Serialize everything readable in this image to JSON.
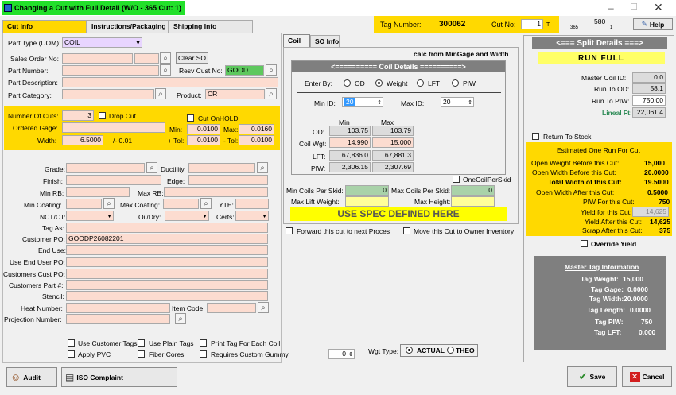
{
  "title": "Changing a Cut with Full Detail  (W/O - 365   Cut: 1)",
  "tag_label": "Tag Number:",
  "tag_number": "300062",
  "cut_no_label": "Cut No:",
  "cut_no": "1",
  "cut_no_suffix": "T",
  "hdr_580": "580",
  "hdr_365": "365",
  "hdr_1": "1",
  "help": "Help",
  "tabs": [
    "Cut Info",
    "Instructions/Packaging",
    "Shipping Info"
  ],
  "left": {
    "part_type_label": "Part Type (UOM):",
    "part_type": "COIL",
    "sales_order_label": "Sales Order No:",
    "clear_so": "Clear SO",
    "part_number_label": "Part Number:",
    "resv_cust_label": "Resv Cust No:",
    "resv_cust": "GOOD",
    "part_desc_label": "Part Description:",
    "part_cat_label": "Part Category:",
    "product_label": "Product:",
    "product": "CR",
    "num_cuts_label": "Number Of Cuts:",
    "num_cuts": "3",
    "drop_cut": "Drop Cut",
    "cut_onhold": "Cut OnHOLD",
    "ordered_gage_label": "Ordered Gage:",
    "min_label": "Min:",
    "min_val": "0.0100",
    "max_label": "Max:",
    "max_val": "0.0160",
    "width_label": "Width:",
    "width": "6.5000",
    "width_tol": "+/- 0.01",
    "ptol_label": "+ Tol:",
    "ptol": "0.0100",
    "mtol_label": "- Tol:",
    "mtol": "0.0100",
    "grade": "Grade:",
    "ductility": "Ductility",
    "finish": "Finish:",
    "edge": "Edge:",
    "min_rb": "Min RB:",
    "max_rb": "Max RB:",
    "min_coating": "Min Coating:",
    "max_coating": "Max Coating:",
    "yte": "YTE:",
    "nct": "NCT/CT:",
    "oildry": "Oil/Dry:",
    "certs": "Certs:",
    "tag_as": "Tag As:",
    "customer_po_label": "Customer PO:",
    "customer_po": "GOODP26082201",
    "end_use": "End Use:",
    "end_user_po": "Use End User PO:",
    "customers_cust_po": "Customers Cust PO:",
    "customers_part": "Customers Part #:",
    "stencil": "Stencil:",
    "heat_number": "Heat Number:",
    "item_code": "Item Code:",
    "projection_number": "Projection Number:",
    "use_customer_tags": "Use Customer Tags",
    "use_plain_tags": "Use Plain Tags",
    "print_tag_each_coil": "Print Tag For Each Coil",
    "apply_pvc": "Apply PVC",
    "fiber_cores": "Fiber Cores",
    "requires_custom_gummy": "Requires Custom Gummy",
    "gummy_val": "0",
    "wgt_type_label": "Wgt Type:",
    "actual": "ACTUAL",
    "theo": "THEO"
  },
  "coil": {
    "tab_coil": "Coil",
    "tab_so": "SO Info",
    "calc_note": "calc from MinGage and Width",
    "details_title": "<========== Coil Details ==========>",
    "enter_by": "Enter By:",
    "od": "OD",
    "weight": "Weight",
    "lft": "LFT",
    "piw": "PIW",
    "min_id_label": "Min ID:",
    "min_id": "20",
    "max_id_label": "Max ID:",
    "max_id": "20",
    "col_min": "Min",
    "col_max": "Max",
    "od_label": "OD:",
    "od_min": "103.75",
    "od_max": "103.79",
    "wgt_label": "Coil Wgt:",
    "wgt_min": "14,990",
    "wgt_max": "15,000",
    "lft_label": "LFT:",
    "lft_min": "67,836.0",
    "lft_max": "67,881.3",
    "piw_label": "PIW:",
    "piw_min": "2,306.15",
    "piw_max": "2,307.69",
    "one_coil": "OneCoilPerSkid",
    "min_coils_label": "Min Coils Per Skid:",
    "min_coils": "0",
    "max_coils_label": "Max Coils Per Skid:",
    "max_coils": "0",
    "max_lift_label": "Max Lift Weight:",
    "max_height_label": "Max Height:",
    "spec_banner": "USE SPEC DEFINED HERE",
    "forward": "Forward this cut to next Proces",
    "move_owner": "Move this Cut to Owner Inventory"
  },
  "split": {
    "title": "<=== Split Details ===>",
    "run_full": "RUN   FULL",
    "master_coil_id_label": "Master Coil ID:",
    "master_coil_id": "0.0",
    "run_to_od_label": "Run To OD:",
    "run_to_od": "58.1",
    "run_to_piw_label": "Run To PIW:",
    "run_to_piw": "750.00",
    "lineal_ft_label": "Lineal Ft:",
    "lineal_ft": "22,061.4",
    "return_to_stock": "Return To Stock",
    "est_title": "Estimated One Run For Cut",
    "open_weight_label": "Open Weight Before this Cut:",
    "open_weight": "15,000",
    "open_width_label": "Open Width Before this Cut:",
    "open_width": "20.0000",
    "total_width_label": "Total Width of this Cut:",
    "total_width": "19.5000",
    "open_width_after_label": "Open Width After this Cut:",
    "open_width_after": "0.5000",
    "piw_for_cut_label": "PIW For this Cut:",
    "piw_for_cut": "750",
    "yield_for_cut_label": "Yield for this Cut:",
    "yield_for_cut": "14,625",
    "yield_after_label": "Yield After this Cut:",
    "yield_after": "14,625",
    "scrap_after_label": "Scrap After this Cut:",
    "scrap_after": "375",
    "override_yield": "Override Yield",
    "master_info_title": "Master Tag Information",
    "tag_weight_label": "Tag Weight:",
    "tag_weight": "15,000",
    "tag_gage_label": "Tag Gage:",
    "tag_gage": "0.0000",
    "tag_width_label": "Tag Width:",
    "tag_width": "20.0000",
    "tag_length_label": "Tag Length:",
    "tag_length": "0.0000",
    "tag_piw_label": "Tag PIW:",
    "tag_piw": "750",
    "tag_lft_label": "Tag LFT:",
    "tag_lft": "0.000"
  },
  "footer": {
    "audit": "Audit",
    "iso": "ISO Complaint",
    "save": "Save",
    "cancel": "Cancel"
  }
}
